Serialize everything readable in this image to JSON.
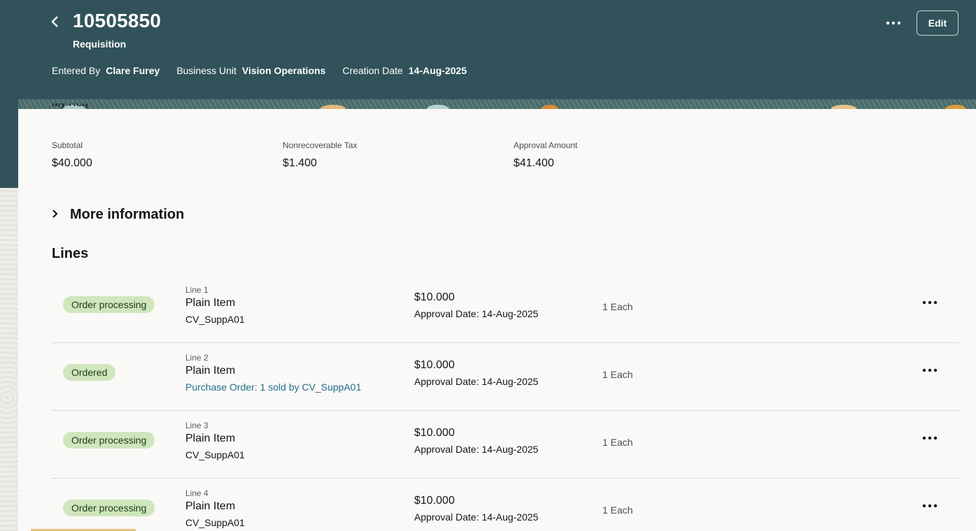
{
  "header": {
    "title": "10505850",
    "subtitle": "Requisition",
    "meta": [
      {
        "label": "Entered By",
        "value": "Clare Furey"
      },
      {
        "label": "Business Unit",
        "value": "Vision Operations"
      },
      {
        "label": "Creation Date",
        "value": "14-Aug-2025"
      }
    ],
    "edit_label": "Edit",
    "back_icon": "chevron-left-icon",
    "more_icon": "more-horizontal-icon"
  },
  "summary": {
    "description": "My Req",
    "subtotal_label": "Subtotal",
    "subtotal_value": "$40.000",
    "tax_label": "Nonrecoverable Tax",
    "tax_value": "$1.400",
    "approval_label": "Approval Amount",
    "approval_value": "$41.400"
  },
  "more_info": {
    "label": "More information"
  },
  "lines": {
    "title": "Lines",
    "rows": [
      {
        "status": "Order processing",
        "line": "Line 1",
        "item": "Plain Item",
        "supplier": "CV_SuppA01",
        "amount": "$10.000",
        "approval_date": "Approval Date: 14-Aug-2025",
        "qty": "1 Each"
      },
      {
        "status": "Ordered",
        "line": "Line 2",
        "item": "Plain Item",
        "supplier": "Purchase Order: 1 sold by CV_SuppA01",
        "amount": "$10.000",
        "approval_date": "Approval Date: 14-Aug-2025",
        "qty": "1 Each"
      },
      {
        "status": "Order processing",
        "line": "Line 3",
        "item": "Plain Item",
        "supplier": "CV_SuppA01",
        "amount": "$10.000",
        "approval_date": "Approval Date: 14-Aug-2025",
        "qty": "1 Each"
      },
      {
        "status": "Order processing",
        "line": "Line 4",
        "item": "Plain Item",
        "supplier": "CV_SuppA01",
        "amount": "$10.000",
        "approval_date": "Approval Date: 14-Aug-2025",
        "qty": "1 Each"
      }
    ]
  },
  "colors": {
    "header_bg": "#31525a",
    "badge_bg": "#cfe6bd",
    "link": "#1f6d8a"
  }
}
